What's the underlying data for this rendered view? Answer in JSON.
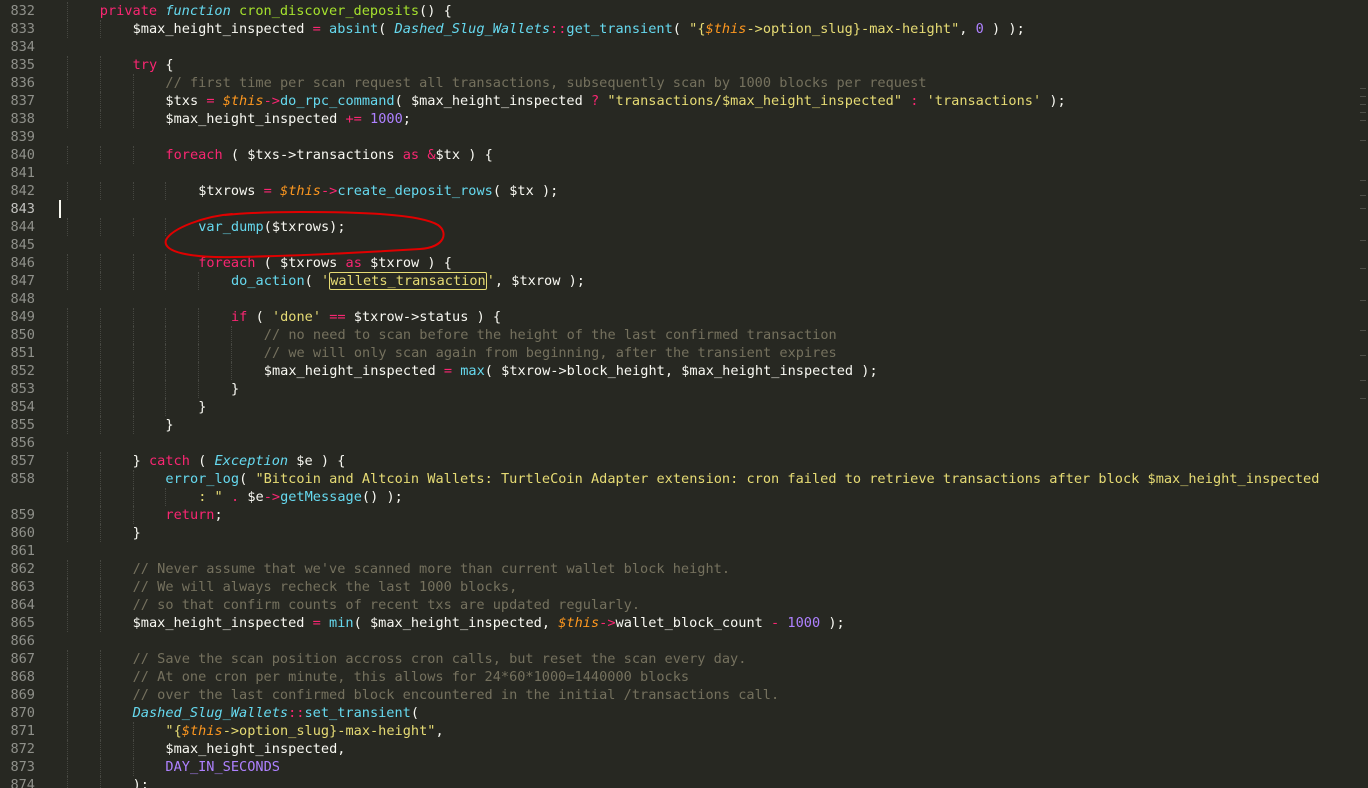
{
  "editor": {
    "theme": "monokai",
    "colors": {
      "background": "#272822",
      "keyword": "#f92672",
      "function": "#a6e22e",
      "string": "#e6db74",
      "number": "#ae81ff",
      "comment": "#75715e",
      "class": "#66d9ef",
      "this": "#fd971f",
      "annotation": "#e00000"
    },
    "active_line": "843",
    "highlighted_word": "wallets_transaction",
    "annotation_note": "red hand-drawn circle around var_dump($txrows);"
  },
  "lines": [
    {
      "n": "832",
      "indent": 4,
      "tokens": [
        [
          "t-kw",
          "private "
        ],
        [
          "t-cls",
          "function "
        ],
        [
          "t-fn",
          "cron_discover_deposits"
        ],
        [
          "t-punc",
          "() {"
        ]
      ]
    },
    {
      "n": "833",
      "indent": 8,
      "tokens": [
        [
          "t-var",
          "$max_height_inspected "
        ],
        [
          "t-op",
          "= "
        ],
        [
          "t-sup",
          "absint"
        ],
        [
          "t-punc",
          "( "
        ],
        [
          "t-cls",
          "Dashed_Slug_Wallets"
        ],
        [
          "t-op",
          "::"
        ],
        [
          "t-sup",
          "get_transient"
        ],
        [
          "t-punc",
          "( "
        ],
        [
          "t-str",
          "\"{"
        ],
        [
          "t-this",
          "$this"
        ],
        [
          "t-str",
          "->option_slug}-max-height\""
        ],
        [
          "t-punc",
          ", "
        ],
        [
          "t-num",
          "0"
        ],
        [
          "t-punc",
          " ) );"
        ]
      ]
    },
    {
      "n": "834",
      "indent": 0,
      "tokens": []
    },
    {
      "n": "835",
      "indent": 8,
      "tokens": [
        [
          "t-kw",
          "try "
        ],
        [
          "t-punc",
          "{"
        ]
      ]
    },
    {
      "n": "836",
      "indent": 12,
      "tokens": [
        [
          "t-cmt",
          "// first time per scan request all transactions, subsequently scan by 1000 blocks per request"
        ]
      ]
    },
    {
      "n": "837",
      "indent": 12,
      "tokens": [
        [
          "t-var",
          "$txs "
        ],
        [
          "t-op",
          "= "
        ],
        [
          "t-this",
          "$this"
        ],
        [
          "t-op",
          "->"
        ],
        [
          "t-sup",
          "do_rpc_command"
        ],
        [
          "t-punc",
          "( "
        ],
        [
          "t-var",
          "$max_height_inspected "
        ],
        [
          "t-op",
          "? "
        ],
        [
          "t-str",
          "\"transactions/$max_height_inspected\""
        ],
        [
          "t-punc",
          " "
        ],
        [
          "t-op",
          ":"
        ],
        [
          "t-punc",
          " "
        ],
        [
          "t-str",
          "'transactions'"
        ],
        [
          "t-punc",
          " );"
        ]
      ]
    },
    {
      "n": "838",
      "indent": 12,
      "tokens": [
        [
          "t-var",
          "$max_height_inspected "
        ],
        [
          "t-op",
          "+= "
        ],
        [
          "t-num",
          "1000"
        ],
        [
          "t-punc",
          ";"
        ]
      ]
    },
    {
      "n": "839",
      "indent": 0,
      "tokens": []
    },
    {
      "n": "840",
      "indent": 12,
      "tokens": [
        [
          "t-kw",
          "foreach "
        ],
        [
          "t-punc",
          "( "
        ],
        [
          "t-var",
          "$txs->transactions "
        ],
        [
          "t-kw",
          "as "
        ],
        [
          "t-op",
          "&"
        ],
        [
          "t-var",
          "$tx "
        ],
        [
          "t-punc",
          ") {"
        ]
      ]
    },
    {
      "n": "841",
      "indent": 0,
      "tokens": []
    },
    {
      "n": "842",
      "indent": 16,
      "tokens": [
        [
          "t-var",
          "$txrows "
        ],
        [
          "t-op",
          "= "
        ],
        [
          "t-this",
          "$this"
        ],
        [
          "t-op",
          "->"
        ],
        [
          "t-sup",
          "create_deposit_rows"
        ],
        [
          "t-punc",
          "( "
        ],
        [
          "t-var",
          "$tx "
        ],
        [
          "t-punc",
          ");"
        ]
      ]
    },
    {
      "n": "843",
      "indent": 0,
      "tokens": []
    },
    {
      "n": "844",
      "indent": 16,
      "tokens": [
        [
          "t-sup",
          "var_dump"
        ],
        [
          "t-punc",
          "("
        ],
        [
          "t-var",
          "$txrows"
        ],
        [
          "t-punc",
          ");"
        ]
      ]
    },
    {
      "n": "845",
      "indent": 0,
      "tokens": []
    },
    {
      "n": "846",
      "indent": 16,
      "tokens": [
        [
          "t-kw",
          "foreach "
        ],
        [
          "t-punc",
          "( "
        ],
        [
          "t-var",
          "$txrows "
        ],
        [
          "t-kw",
          "as "
        ],
        [
          "t-var",
          "$txrow "
        ],
        [
          "t-punc",
          ") {"
        ]
      ]
    },
    {
      "n": "847",
      "indent": 20,
      "tokens": [
        [
          "t-sup",
          "do_action"
        ],
        [
          "t-punc",
          "( "
        ],
        [
          "t-str",
          "'"
        ],
        [
          "t-str hl-box",
          "wallets_transaction"
        ],
        [
          "t-str",
          "'"
        ],
        [
          "t-punc",
          ", "
        ],
        [
          "t-var",
          "$txrow "
        ],
        [
          "t-punc",
          ");"
        ]
      ]
    },
    {
      "n": "848",
      "indent": 0,
      "tokens": []
    },
    {
      "n": "849",
      "indent": 20,
      "tokens": [
        [
          "t-kw",
          "if "
        ],
        [
          "t-punc",
          "( "
        ],
        [
          "t-str",
          "'done' "
        ],
        [
          "t-op",
          "== "
        ],
        [
          "t-var",
          "$txrow->status "
        ],
        [
          "t-punc",
          ") {"
        ]
      ]
    },
    {
      "n": "850",
      "indent": 24,
      "tokens": [
        [
          "t-cmt",
          "// no need to scan before the height of the last confirmed transaction"
        ]
      ]
    },
    {
      "n": "851",
      "indent": 24,
      "tokens": [
        [
          "t-cmt",
          "// we will only scan again from beginning, after the transient expires"
        ]
      ]
    },
    {
      "n": "852",
      "indent": 24,
      "tokens": [
        [
          "t-var",
          "$max_height_inspected "
        ],
        [
          "t-op",
          "= "
        ],
        [
          "t-sup",
          "max"
        ],
        [
          "t-punc",
          "( "
        ],
        [
          "t-var",
          "$txrow->block_height"
        ],
        [
          "t-punc",
          ", "
        ],
        [
          "t-var",
          "$max_height_inspected "
        ],
        [
          "t-punc",
          ");"
        ]
      ]
    },
    {
      "n": "853",
      "indent": 20,
      "tokens": [
        [
          "t-punc",
          "}"
        ]
      ]
    },
    {
      "n": "854",
      "indent": 16,
      "tokens": [
        [
          "t-punc",
          "}"
        ]
      ]
    },
    {
      "n": "855",
      "indent": 12,
      "tokens": [
        [
          "t-punc",
          "}"
        ]
      ]
    },
    {
      "n": "856",
      "indent": 0,
      "tokens": []
    },
    {
      "n": "857",
      "indent": 8,
      "tokens": [
        [
          "t-punc",
          "} "
        ],
        [
          "t-kw",
          "catch "
        ],
        [
          "t-punc",
          "( "
        ],
        [
          "t-cls",
          "Exception "
        ],
        [
          "t-var",
          "$e "
        ],
        [
          "t-punc",
          ") {"
        ]
      ]
    },
    {
      "n": "858",
      "indent": 12,
      "tokens": [
        [
          "t-sup",
          "error_log"
        ],
        [
          "t-punc",
          "( "
        ],
        [
          "t-str",
          "\"Bitcoin and Altcoin Wallets: TurtleCoin Adapter extension: cron failed to retrieve transactions after block $max_height_inspected"
        ]
      ]
    },
    {
      "n": "",
      "indent": 16,
      "tokens": [
        [
          "t-str",
          ": \""
        ],
        [
          "t-punc",
          " "
        ],
        [
          "t-op",
          "."
        ],
        [
          "t-punc",
          " "
        ],
        [
          "t-var",
          "$e"
        ],
        [
          "t-op",
          "->"
        ],
        [
          "t-sup",
          "getMessage"
        ],
        [
          "t-punc",
          "() );"
        ]
      ]
    },
    {
      "n": "859",
      "indent": 12,
      "tokens": [
        [
          "t-kw",
          "return"
        ],
        [
          "t-punc",
          ";"
        ]
      ]
    },
    {
      "n": "860",
      "indent": 8,
      "tokens": [
        [
          "t-punc",
          "}"
        ]
      ]
    },
    {
      "n": "861",
      "indent": 0,
      "tokens": []
    },
    {
      "n": "862",
      "indent": 8,
      "tokens": [
        [
          "t-cmt",
          "// Never assume that we've scanned more than current wallet block height."
        ]
      ]
    },
    {
      "n": "863",
      "indent": 8,
      "tokens": [
        [
          "t-cmt",
          "// We will always recheck the last 1000 blocks,"
        ]
      ]
    },
    {
      "n": "864",
      "indent": 8,
      "tokens": [
        [
          "t-cmt",
          "// so that confirm counts of recent txs are updated regularly."
        ]
      ]
    },
    {
      "n": "865",
      "indent": 8,
      "tokens": [
        [
          "t-var",
          "$max_height_inspected "
        ],
        [
          "t-op",
          "= "
        ],
        [
          "t-sup",
          "min"
        ],
        [
          "t-punc",
          "( "
        ],
        [
          "t-var",
          "$max_height_inspected"
        ],
        [
          "t-punc",
          ", "
        ],
        [
          "t-this",
          "$this"
        ],
        [
          "t-op",
          "->"
        ],
        [
          "t-var",
          "wallet_block_count "
        ],
        [
          "t-op",
          "- "
        ],
        [
          "t-num",
          "1000"
        ],
        [
          "t-punc",
          " );"
        ]
      ]
    },
    {
      "n": "866",
      "indent": 0,
      "tokens": []
    },
    {
      "n": "867",
      "indent": 8,
      "tokens": [
        [
          "t-cmt",
          "// Save the scan position accross cron calls, but reset the scan every day."
        ]
      ]
    },
    {
      "n": "868",
      "indent": 8,
      "tokens": [
        [
          "t-cmt",
          "// At one cron per minute, this allows for 24*60*1000=1440000 blocks"
        ]
      ]
    },
    {
      "n": "869",
      "indent": 8,
      "tokens": [
        [
          "t-cmt",
          "// over the last confirmed block encountered in the initial /transactions call."
        ]
      ]
    },
    {
      "n": "870",
      "indent": 8,
      "tokens": [
        [
          "t-cls",
          "Dashed_Slug_Wallets"
        ],
        [
          "t-op",
          "::"
        ],
        [
          "t-sup",
          "set_transient"
        ],
        [
          "t-punc",
          "("
        ]
      ]
    },
    {
      "n": "871",
      "indent": 12,
      "tokens": [
        [
          "t-str",
          "\"{"
        ],
        [
          "t-this",
          "$this"
        ],
        [
          "t-str",
          "->option_slug}-max-height\""
        ],
        [
          "t-punc",
          ","
        ]
      ]
    },
    {
      "n": "872",
      "indent": 12,
      "tokens": [
        [
          "t-var",
          "$max_height_inspected"
        ],
        [
          "t-punc",
          ","
        ]
      ]
    },
    {
      "n": "873",
      "indent": 12,
      "tokens": [
        [
          "t-const",
          "DAY_IN_SECONDS"
        ]
      ]
    },
    {
      "n": "874",
      "indent": 8,
      "tokens": [
        [
          "t-punc",
          ");"
        ]
      ]
    }
  ]
}
